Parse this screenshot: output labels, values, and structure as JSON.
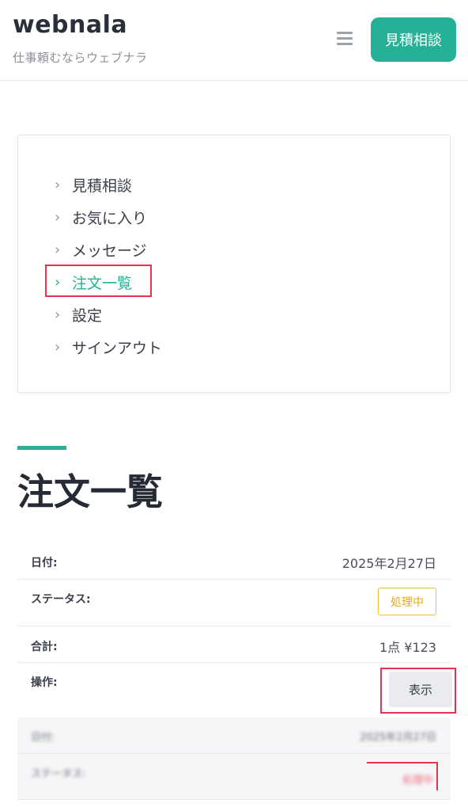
{
  "header": {
    "brand": "webnala",
    "tagline": "仕事頼むならウェブナラ",
    "menu_icon": "hamburger-menu-icon",
    "cta_label": "見積相談",
    "accent_color": "#26b197"
  },
  "nav": {
    "chevron": "›",
    "items": [
      {
        "label": "見積相談"
      },
      {
        "label": "お気に入り"
      },
      {
        "label": "メッセージ"
      },
      {
        "label": "注文一覧",
        "active": true
      },
      {
        "label": "設定"
      },
      {
        "label": "サインアウト"
      }
    ]
  },
  "page": {
    "title": "注文一覧"
  },
  "order": {
    "date_label": "日付:",
    "date_value": "2025年2月27日",
    "status_label": "ステータス:",
    "status_value": "処理中",
    "total_label": "合計:",
    "total_value": "1点 ¥123",
    "action_label": "操作:",
    "view_button": "表示"
  },
  "blurred_rows": {
    "row1_label": "日付:",
    "row1_value": "2025年2月27日",
    "row2_label": "ステータス:",
    "row2_value": "処理中"
  }
}
